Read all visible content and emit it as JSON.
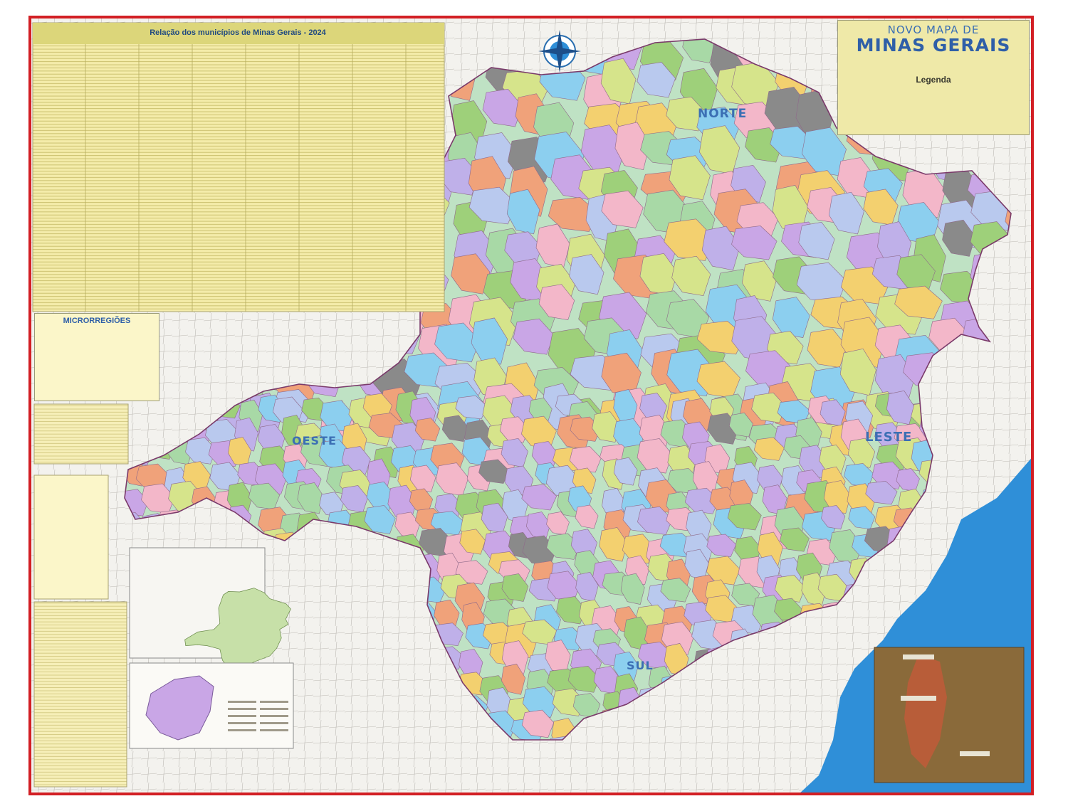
{
  "map": {
    "title_line1": "NOVO MAPA DE",
    "title_line2": "MINAS GERAIS",
    "legend_heading": "Legenda",
    "table_title": "Relação dos municípios de Minas Gerais - 2024",
    "microregions_title": "MICRORREGIÕES",
    "region_labels": {
      "norte": "NORTE",
      "leste": "LESTE",
      "oeste": "OESTE",
      "sul": "SUL"
    },
    "colors": {
      "border_red": "#d21f24",
      "paper": "#f4f3ef",
      "ocean": "#2f8fd8",
      "neighbor_land": "#f1efe9",
      "table_bg": "#f4ecaa",
      "label_blue": "#3b6fb4",
      "municipality_palette": [
        "#c9a6e6",
        "#9ed07a",
        "#8ccfef",
        "#f3d06f",
        "#f0a27a",
        "#d6e48b",
        "#bfb0e9",
        "#a8d9a6",
        "#f3b7c9",
        "#b9c9ee"
      ]
    }
  }
}
